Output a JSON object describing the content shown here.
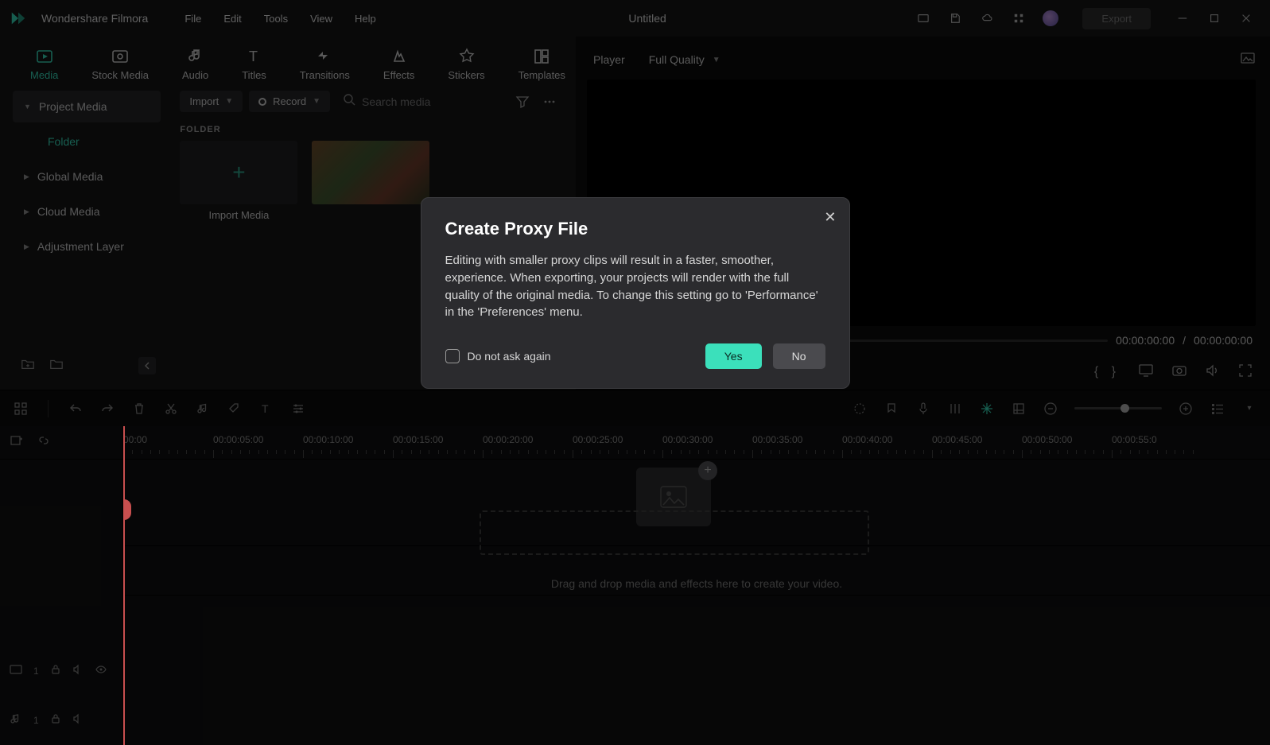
{
  "app": {
    "name": "Wondershare Filmora",
    "doc_title": "Untitled",
    "export_label": "Export"
  },
  "menu": {
    "items": [
      "File",
      "Edit",
      "Tools",
      "View",
      "Help"
    ]
  },
  "tabs": [
    {
      "id": "media",
      "label": "Media",
      "active": true
    },
    {
      "id": "stock",
      "label": "Stock Media"
    },
    {
      "id": "audio",
      "label": "Audio"
    },
    {
      "id": "titles",
      "label": "Titles"
    },
    {
      "id": "transitions",
      "label": "Transitions"
    },
    {
      "id": "effects",
      "label": "Effects"
    },
    {
      "id": "stickers",
      "label": "Stickers"
    },
    {
      "id": "templates",
      "label": "Templates"
    }
  ],
  "library": {
    "project": "Project Media",
    "folder_child": "Folder",
    "global": "Global Media",
    "cloud": "Cloud Media",
    "adjust": "Adjustment Layer"
  },
  "bin": {
    "import": "Import",
    "record": "Record",
    "search_placeholder": "Search media",
    "folder_heading": "FOLDER",
    "import_card": "Import Media"
  },
  "player": {
    "label": "Player",
    "quality": "Full Quality",
    "time_current": "00:00:00:00",
    "time_separator": "/",
    "time_total": "00:00:00:00"
  },
  "timeline": {
    "marks": [
      "00:00",
      "00:00:05:00",
      "00:00:10:00",
      "00:00:15:00",
      "00:00:20:00",
      "00:00:25:00",
      "00:00:30:00",
      "00:00:35:00",
      "00:00:40:00",
      "00:00:45:00",
      "00:00:50:00",
      "00:00:55:0"
    ],
    "video_track_index": "1",
    "audio_track_index": "1",
    "hint": "Drag and drop media and effects here to create your video."
  },
  "modal": {
    "title": "Create Proxy File",
    "body": "Editing with smaller proxy clips will result in a faster, smoother, experience. When exporting, your projects will render with the full quality of the original media. To change this setting go to 'Performance' in the 'Preferences' menu.",
    "dont_ask": "Do not ask again",
    "yes": "Yes",
    "no": "No"
  },
  "colors": {
    "accent": "#34d1b2"
  }
}
